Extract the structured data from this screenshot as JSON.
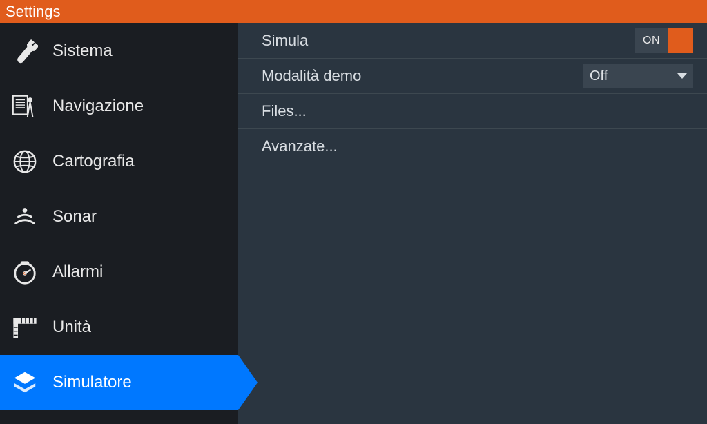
{
  "titlebar": {
    "title": "Settings"
  },
  "sidebar": {
    "items": [
      {
        "id": "sistema",
        "label": "Sistema",
        "icon": "wrench-icon",
        "selected": false
      },
      {
        "id": "navigazione",
        "label": "Navigazione",
        "icon": "compass-icon",
        "selected": false
      },
      {
        "id": "cartografia",
        "label": "Cartografia",
        "icon": "globe-icon",
        "selected": false
      },
      {
        "id": "sonar",
        "label": "Sonar",
        "icon": "sonar-icon",
        "selected": false
      },
      {
        "id": "allarmi",
        "label": "Allarmi",
        "icon": "alarm-icon",
        "selected": false
      },
      {
        "id": "unita",
        "label": "Unità",
        "icon": "ruler-icon",
        "selected": false
      },
      {
        "id": "simulatore",
        "label": "Simulatore",
        "icon": "layers-icon",
        "selected": true
      }
    ]
  },
  "content": {
    "rows": {
      "simula": {
        "label": "Simula",
        "toggle_state": "ON"
      },
      "demo": {
        "label": "Modalità demo",
        "dropdown_value": "Off"
      },
      "files": {
        "label": "Files..."
      },
      "avanzate": {
        "label": "Avanzate..."
      }
    }
  },
  "colors": {
    "accent": "#e05c1c",
    "selected": "#0078ff",
    "sidebar_bg": "#1a1d22",
    "content_bg": "#2a3540"
  }
}
